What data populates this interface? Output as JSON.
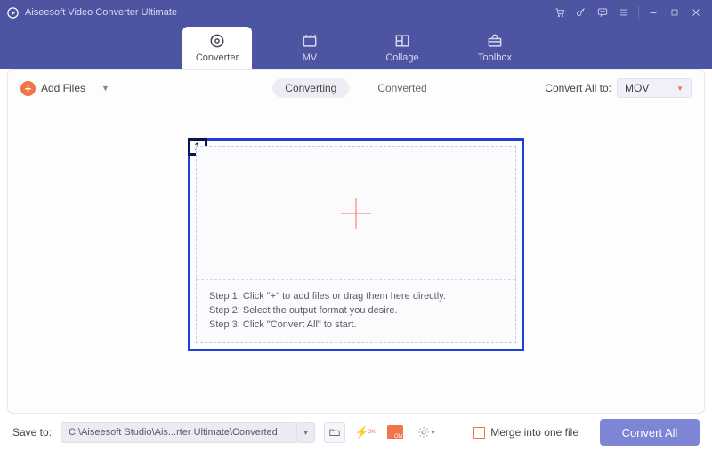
{
  "title": "Aiseesoft Video Converter Ultimate",
  "nav": {
    "tabs": [
      {
        "label": "Converter"
      },
      {
        "label": "MV"
      },
      {
        "label": "Collage"
      },
      {
        "label": "Toolbox"
      }
    ]
  },
  "toolbar": {
    "add_label": "Add Files",
    "subtabs": {
      "converting": "Converting",
      "converted": "Converted"
    },
    "convert_to_label": "Convert All to:",
    "format": "MOV"
  },
  "drop": {
    "badge": "1",
    "step1": "Step 1: Click \"+\" to add files or drag them here directly.",
    "step2": "Step 2: Select the output format you desire.",
    "step3": "Step 3: Click \"Convert All\" to start."
  },
  "footer": {
    "save_to_label": "Save to:",
    "path": "C:\\Aiseesoft Studio\\Ais...rter Ultimate\\Converted",
    "merge_label": "Merge into one file",
    "convert_label": "Convert All"
  }
}
